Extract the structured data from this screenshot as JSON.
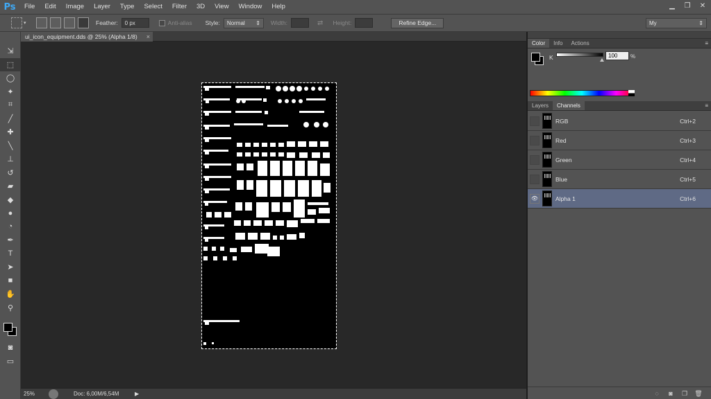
{
  "app": {
    "logo": "Ps"
  },
  "menu": [
    "File",
    "Edit",
    "Image",
    "Layer",
    "Type",
    "Select",
    "Filter",
    "3D",
    "View",
    "Window",
    "Help"
  ],
  "window_controls": {
    "minimize": "▁",
    "restore": "❐",
    "close": "✕"
  },
  "options": {
    "feather_label": "Feather:",
    "feather_value": "0 px",
    "antialias_label": "Anti-alias",
    "style_label": "Style:",
    "style_value": "Normal",
    "width_label": "Width:",
    "height_label": "Height:",
    "refine_edge": "Refine Edge...",
    "workspace": "My"
  },
  "tools": [
    {
      "name": "move-tool",
      "icon": "⇲"
    },
    {
      "name": "rect-marquee-tool",
      "icon": "⬚",
      "active": true
    },
    {
      "name": "lasso-tool",
      "icon": "◯"
    },
    {
      "name": "magic-wand-tool",
      "icon": "✦"
    },
    {
      "name": "crop-tool",
      "icon": "⌗"
    },
    {
      "name": "eyedropper-tool",
      "icon": "╱"
    },
    {
      "name": "healing-brush-tool",
      "icon": "✚"
    },
    {
      "name": "brush-tool",
      "icon": "╲"
    },
    {
      "name": "clone-stamp-tool",
      "icon": "⊥"
    },
    {
      "name": "history-brush-tool",
      "icon": "↺"
    },
    {
      "name": "eraser-tool",
      "icon": "▰"
    },
    {
      "name": "paint-bucket-tool",
      "icon": "◆"
    },
    {
      "name": "blur-tool",
      "icon": "●"
    },
    {
      "name": "dodge-tool",
      "icon": "◔"
    },
    {
      "name": "pen-tool",
      "icon": "✒"
    },
    {
      "name": "type-tool",
      "icon": "T"
    },
    {
      "name": "path-selection-tool",
      "icon": "➤"
    },
    {
      "name": "shape-tool",
      "icon": "■"
    },
    {
      "name": "hand-tool",
      "icon": "✋"
    },
    {
      "name": "zoom-tool",
      "icon": "⚲"
    }
  ],
  "document": {
    "tab_title": "ui_icon_equipment.dds @ 25% (Alpha 1/8)",
    "close": "×"
  },
  "status": {
    "zoom": "25%",
    "doc_info": "Doc: 6,00M/6,54M",
    "arrow": "▶"
  },
  "color_panel": {
    "tabs": [
      "Color",
      "Info",
      "Actions"
    ],
    "active_tab": "Color",
    "channel_label": "K",
    "value": "100",
    "unit": "%"
  },
  "channels_panel": {
    "tabs": [
      "Layers",
      "Channels"
    ],
    "active_tab": "Channels",
    "channels": [
      {
        "name": "RGB",
        "shortcut": "Ctrl+2",
        "visible": false,
        "selected": false
      },
      {
        "name": "Red",
        "shortcut": "Ctrl+3",
        "visible": false,
        "selected": false
      },
      {
        "name": "Green",
        "shortcut": "Ctrl+4",
        "visible": false,
        "selected": false
      },
      {
        "name": "Blue",
        "shortcut": "Ctrl+5",
        "visible": false,
        "selected": false
      },
      {
        "name": "Alpha 1",
        "shortcut": "Ctrl+6",
        "visible": true,
        "selected": true
      }
    ],
    "footer_icons": [
      "load-selection-icon",
      "save-selection-icon",
      "new-channel-icon",
      "delete-channel-icon"
    ]
  }
}
